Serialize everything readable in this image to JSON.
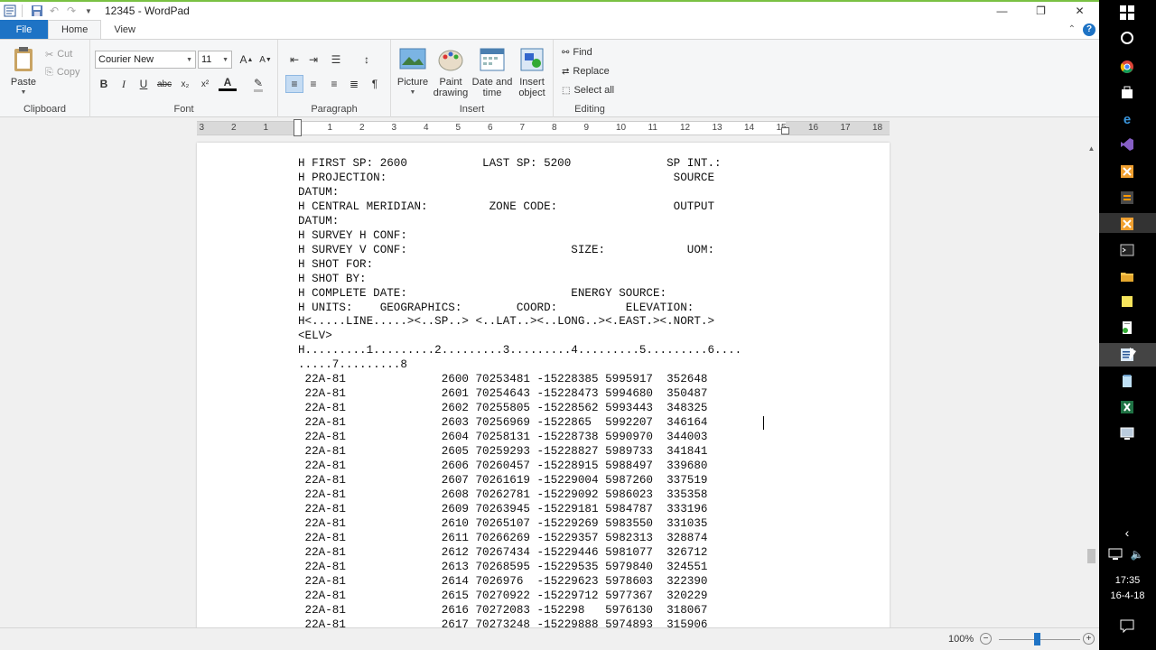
{
  "window": {
    "title": "12345 - WordPad",
    "minimize_label": "—",
    "restore_label": "❐",
    "close_label": "✕"
  },
  "tabs": {
    "file": "File",
    "home": "Home",
    "view": "View"
  },
  "ribbon": {
    "clipboard": {
      "label": "Clipboard",
      "paste": "Paste",
      "cut": "Cut",
      "copy": "Copy"
    },
    "font": {
      "label": "Font",
      "family": "Courier New",
      "size": "11",
      "bold": "B",
      "italic": "I",
      "underline": "U",
      "strike": "abc",
      "subscript": "x₂",
      "superscript": "x²",
      "color": "A"
    },
    "paragraph": {
      "label": "Paragraph"
    },
    "insert": {
      "label": "Insert",
      "picture": "Picture",
      "paint_line1": "Paint",
      "paint_line2": "drawing",
      "datetime_line1": "Date and",
      "datetime_line2": "time",
      "object_line1": "Insert",
      "object_line2": "object"
    },
    "editing": {
      "label": "Editing",
      "find": "Find",
      "replace": "Replace",
      "select_all": "Select all"
    }
  },
  "ruler": {
    "numbers": [
      "3",
      "2",
      "1",
      "1",
      "2",
      "3",
      "4",
      "5",
      "6",
      "7",
      "8",
      "9",
      "10",
      "11",
      "12",
      "13",
      "14",
      "15",
      "16",
      "17",
      "18"
    ]
  },
  "document": {
    "lines": [
      "H FIRST SP: 2600           LAST SP: 5200              SP INT.:",
      "H PROJECTION:                                          SOURCE",
      "DATUM:",
      "H CENTRAL MERIDIAN:         ZONE CODE:                 OUTPUT",
      "DATUM:",
      "H SURVEY H CONF:",
      "H SURVEY V CONF:                        SIZE:            UOM:",
      "H SHOT FOR:",
      "H SHOT BY:",
      "H COMPLETE DATE:                        ENERGY SOURCE:",
      "H UNITS:    GEOGRAPHICS:        COORD:          ELEVATION:",
      "H<.....LINE.....><..SP..> <..LAT..><..LONG..><.EAST.><.NORT.>",
      "<ELV>",
      "H.........1.........2.........3.........4.........5.........6....",
      ".....7.........8",
      " 22A-81              2600 70253481 -15228385 5995917  352648",
      " 22A-81              2601 70254643 -15228473 5994680  350487",
      " 22A-81              2602 70255805 -15228562 5993443  348325",
      " 22A-81              2603 70256969 -1522865  5992207  346164",
      " 22A-81              2604 70258131 -15228738 5990970  344003",
      " 22A-81              2605 70259293 -15228827 5989733  341841",
      " 22A-81              2606 70260457 -15228915 5988497  339680",
      " 22A-81              2607 70261619 -15229004 5987260  337519",
      " 22A-81              2608 70262781 -15229092 5986023  335358",
      " 22A-81              2609 70263945 -15229181 5984787  333196",
      " 22A-81              2610 70265107 -15229269 5983550  331035",
      " 22A-81              2611 70266269 -15229357 5982313  328874",
      " 22A-81              2612 70267434 -15229446 5981077  326712",
      " 22A-81              2613 70268595 -15229535 5979840  324551",
      " 22A-81              2614 7026976  -15229623 5978603  322390",
      " 22A-81              2615 70270922 -15229712 5977367  320229",
      " 22A-81              2616 70272083 -152298   5976130  318067",
      " 22A-81              2617 70273248 -15229888 5974893  315906"
    ]
  },
  "status": {
    "zoom": "100%",
    "zoom_out": "−",
    "zoom_in": "+"
  },
  "taskbar": {
    "time": "17:35",
    "date": "16-4-18"
  }
}
